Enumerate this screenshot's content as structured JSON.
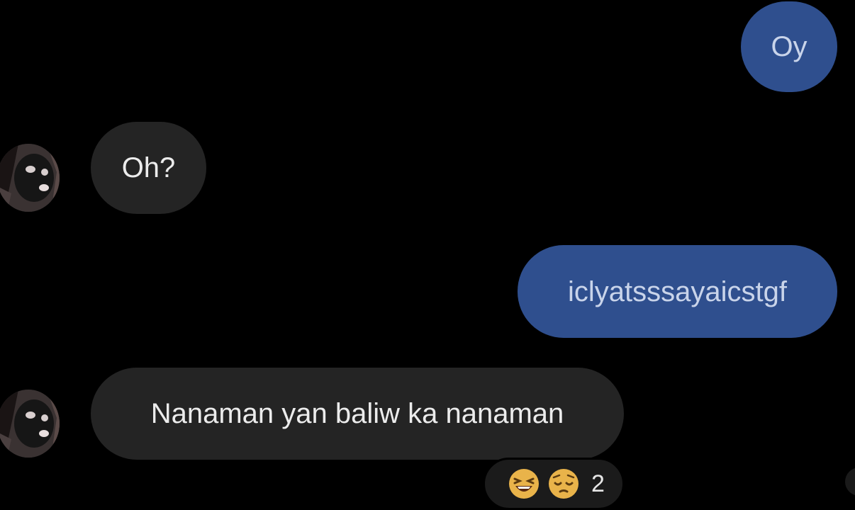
{
  "chat": {
    "messages": [
      {
        "direction": "outgoing",
        "text": "Oy"
      },
      {
        "direction": "incoming",
        "text": "Oh?"
      },
      {
        "direction": "outgoing",
        "text": "iclyatsssayaicstgf"
      },
      {
        "direction": "incoming",
        "text": "Nanaman yan baliw ka nanaman"
      }
    ],
    "reactions": {
      "icons": [
        "laughing-face-icon",
        "pensive-face-icon"
      ],
      "count": "2"
    }
  },
  "colors": {
    "background": "#000000",
    "outgoing_bubble": "#2f4f8e",
    "incoming_bubble": "#242424",
    "reaction_pill": "#1b1b1b"
  }
}
